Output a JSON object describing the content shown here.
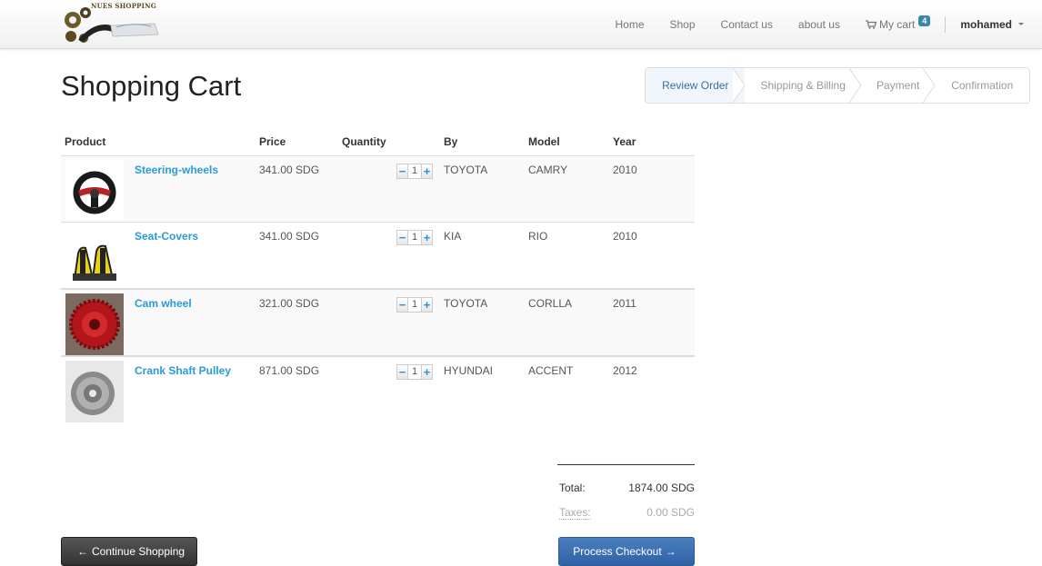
{
  "brand": {
    "logo_text": "NUES SHOPPING"
  },
  "nav": {
    "links": [
      "Home",
      "Shop",
      "Contact us",
      "about us"
    ],
    "cart_label": "My cart",
    "cart_count": "4",
    "user": "mohamed"
  },
  "page_title": "Shopping Cart",
  "steps": [
    "Review Order",
    "Shipping & Billing",
    "Payment",
    "Confirmation"
  ],
  "active_step": "Review Order",
  "table": {
    "headers": [
      "Product",
      "Price",
      "Quantity",
      "By",
      "Model",
      "Year"
    ],
    "rows": [
      {
        "name": "Steering-wheels",
        "price": "341.00 SDG",
        "qty": "1",
        "by": "TOYOTA",
        "model": "CAMRY",
        "year": "2010",
        "image_icon": "steering-wheel-icon"
      },
      {
        "name": "Seat-Covers",
        "price": "341.00 SDG",
        "qty": "1",
        "by": "KIA",
        "model": "RIO",
        "year": "2010",
        "image_icon": "seat-covers-icon"
      },
      {
        "name": "Cam wheel",
        "price": "321.00 SDG",
        "qty": "1",
        "by": "TOYOTA",
        "model": "CORLLA",
        "year": "2011",
        "image_icon": "cam-wheel-icon"
      },
      {
        "name": "Crank Shaft Pulley",
        "price": "871.00 SDG",
        "qty": "1",
        "by": "HYUNDAI",
        "model": "ACCENT",
        "year": "2012",
        "image_icon": "pulley-icon"
      }
    ]
  },
  "totals": {
    "total_label": "Total:",
    "total_value": "1874.00 SDG",
    "tax_label": "Taxes:",
    "tax_value": "0.00 SDG"
  },
  "buttons": {
    "continue": "Continue Shopping",
    "checkout": "Process Checkout"
  },
  "colors": {
    "link": "#2a9ad8",
    "badge": "#3a87ad",
    "checkout": "#3a6fb3",
    "continue": "#444444"
  }
}
